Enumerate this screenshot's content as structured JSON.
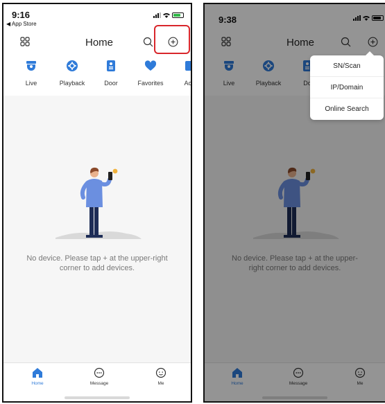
{
  "left": {
    "status": {
      "time": "9:16",
      "back": "◀ App Store"
    },
    "header": {
      "title": "Home"
    },
    "quick_menu": [
      {
        "label": "Live",
        "icon": "camera-icon"
      },
      {
        "label": "Playback",
        "icon": "playback-icon"
      },
      {
        "label": "Door",
        "icon": "door-icon"
      },
      {
        "label": "Favorites",
        "icon": "heart-icon"
      },
      {
        "label": "Acc",
        "icon": "access-icon"
      }
    ],
    "empty_message": "No device. Please tap + at the upper-right corner to add devices.",
    "tabs": [
      {
        "label": "Home",
        "icon": "home-icon",
        "active": true
      },
      {
        "label": "Message",
        "icon": "message-icon",
        "active": false
      },
      {
        "label": "Me",
        "icon": "me-icon",
        "active": false
      }
    ]
  },
  "right": {
    "status": {
      "time": "9:38"
    },
    "header": {
      "title": "Home"
    },
    "quick_menu": [
      {
        "label": "Live"
      },
      {
        "label": "Playback"
      },
      {
        "label": "Do"
      }
    ],
    "empty_message": "No device. Please tap + at the upper-right corner to add devices.",
    "dropdown": [
      "SN/Scan",
      "IP/Domain",
      "Online Search"
    ],
    "tabs": [
      {
        "label": "Home",
        "active": true
      },
      {
        "label": "Message",
        "active": false
      },
      {
        "label": "Me",
        "active": false
      }
    ]
  },
  "colors": {
    "accent": "#2f7bd9",
    "highlight": "#d8262b",
    "battery": "#2fb846"
  }
}
